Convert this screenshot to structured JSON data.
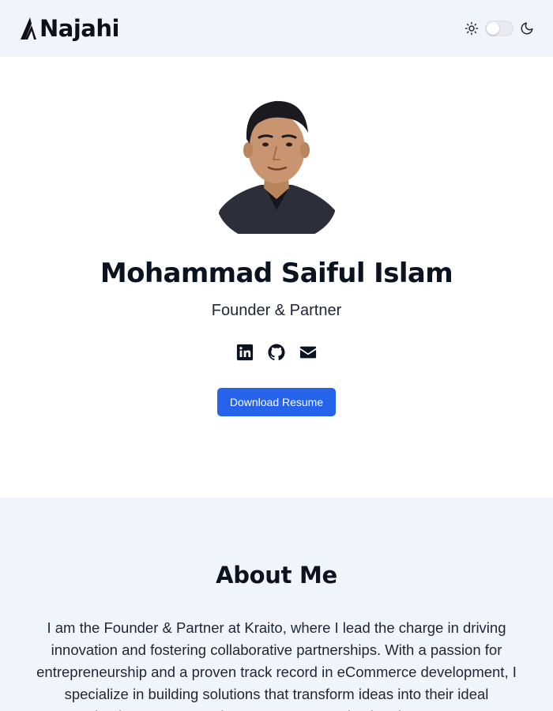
{
  "header": {
    "logo_text": "Najahi",
    "icons": {
      "light": "sun-icon",
      "dark": "moon-icon"
    },
    "theme_toggle_on": false
  },
  "profile": {
    "name": "Mohammad Saiful Islam",
    "role": "Founder & Partner",
    "socials": [
      {
        "icon": "linkedin-icon"
      },
      {
        "icon": "github-icon"
      },
      {
        "icon": "email-icon"
      }
    ],
    "resume_button": "Download Resume"
  },
  "about": {
    "title": "About Me",
    "text": "I am the Founder & Partner at Kraito, where I lead the charge in driving innovation and fostering collaborative partnerships. With a passion for entrepreneurship and a proven track record in eCommerce development, I specialize in building solutions that transform ideas into their ideal business. My experience spans strategic planning, team"
  },
  "colors": {
    "header_bg": "#f1f4fb",
    "accent": "#2563eb",
    "text": "#0f172a"
  }
}
